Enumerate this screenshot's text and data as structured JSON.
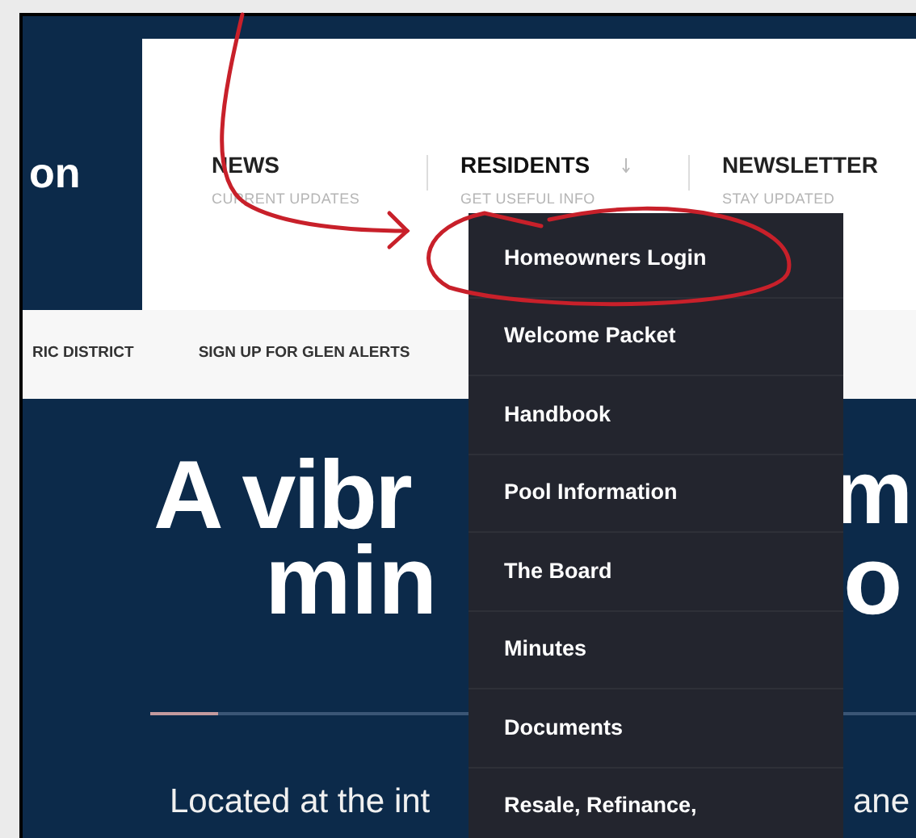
{
  "header": {
    "logo_text": "on",
    "nav": [
      {
        "label": "NEWS",
        "sub": "CURRENT UPDATES",
        "has_dropdown": false,
        "expanded": false
      },
      {
        "label": "RESIDENTS",
        "sub": "GET USEFUL INFO",
        "has_dropdown": true,
        "expanded": true
      },
      {
        "label": "NEWSLETTER",
        "sub": "STAY UPDATED",
        "has_dropdown": false,
        "expanded": false
      }
    ]
  },
  "subnav": [
    "RIC DISTRICT",
    "SIGN UP FOR GLEN ALERTS"
  ],
  "dropdown": {
    "items": [
      "Homeowners Login",
      "Welcome Packet",
      "Handbook",
      "Pool Information",
      "The Board",
      "Minutes",
      "Documents",
      "Resale, Refinance,"
    ]
  },
  "hero": {
    "line_1": [
      "A vibr",
      "m"
    ],
    "line_2": [
      "min",
      "o"
    ],
    "intro": [
      "Located at the int",
      "ane"
    ]
  },
  "annotations": {
    "arrow": true,
    "circle": true
  }
}
